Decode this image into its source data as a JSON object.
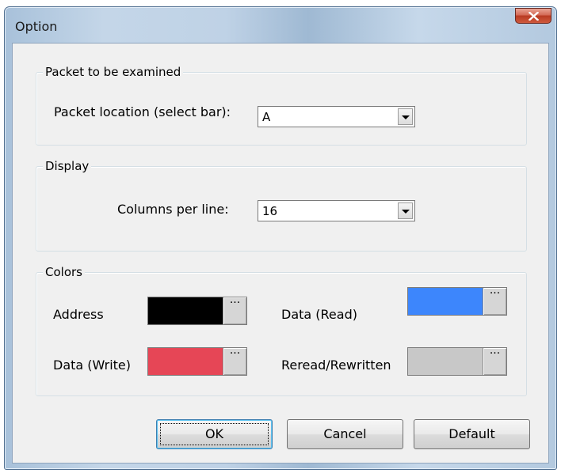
{
  "window": {
    "title": "Option"
  },
  "packet_group": {
    "legend": "Packet to be examined",
    "location_label": "Packet location (select bar):",
    "location_value": "A"
  },
  "display_group": {
    "legend": "Display",
    "columns_label": "Columns per line:",
    "columns_value": "16"
  },
  "colors_group": {
    "legend": "Colors",
    "dots": "···",
    "address": {
      "label": "Address",
      "color": "#000000"
    },
    "data_read": {
      "label": "Data (Read)",
      "color": "#3d86fc"
    },
    "data_write": {
      "label": "Data (Write)",
      "color": "#e64656"
    },
    "reread": {
      "label": "Reread/Rewritten",
      "color": "#c8c8c8"
    }
  },
  "buttons": {
    "ok": "OK",
    "cancel": "Cancel",
    "default": "Default"
  }
}
